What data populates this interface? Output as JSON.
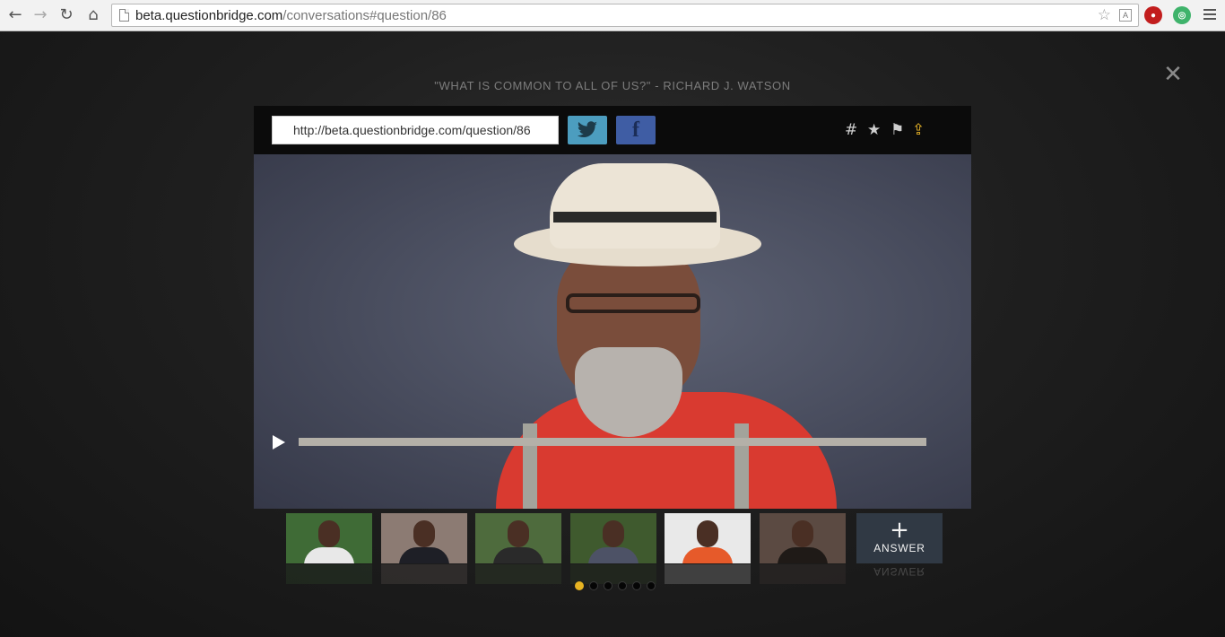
{
  "browser": {
    "url_host": "beta.questionbridge.com",
    "url_path": "/conversations#question/86",
    "back_icon": "back-arrow-icon",
    "forward_icon": "forward-arrow-icon",
    "reload_icon": "reload-icon",
    "home_icon": "home-icon"
  },
  "modal": {
    "title": "\"WHAT IS COMMON TO ALL OF US?\" - RICHARD J. WATSON",
    "share_url": "http://beta.questionbridge.com/question/86",
    "twitter_glyph": "🐦",
    "facebook_glyph": "f",
    "tools": {
      "hash": "#",
      "star": "★",
      "flag": "⚑",
      "share": "⇪"
    },
    "close_glyph": "✕"
  },
  "video": {
    "progress_fraction": 0.0
  },
  "thumbnails": {
    "items": [
      {
        "bg": "#3f6b36",
        "body": "#e8e8e8"
      },
      {
        "bg": "#8c7b73",
        "body": "#1e1f26"
      },
      {
        "bg": "#4e6b3d",
        "body": "#2a2a2a"
      },
      {
        "bg": "#3f5a2e",
        "body": "#4d5266"
      },
      {
        "bg": "#e9e9e9",
        "body": "#e65a2a"
      },
      {
        "bg": "#5b4a42",
        "body": "#1f1a17"
      }
    ],
    "answer_plus": "+",
    "answer_label": "ANSWER"
  },
  "pager": {
    "count": 6,
    "active": 0
  }
}
